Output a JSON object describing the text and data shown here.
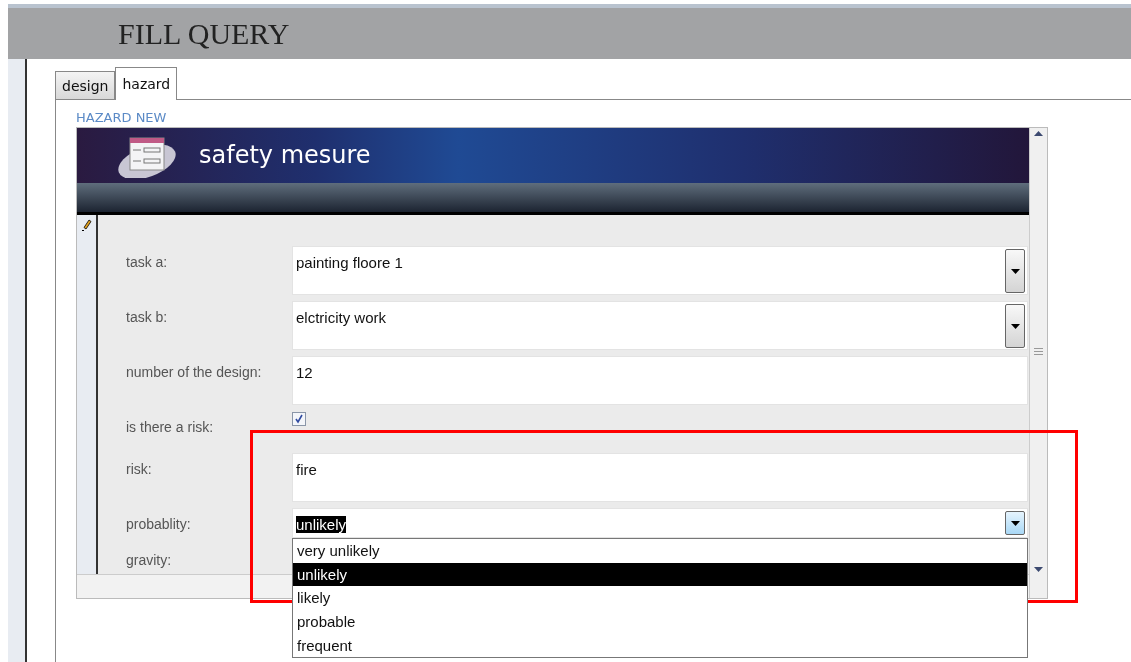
{
  "window": {
    "title": "FILL QUERY"
  },
  "tabs": [
    {
      "label": "design",
      "selected": false
    },
    {
      "label": "hazard",
      "selected": true
    }
  ],
  "form": {
    "caption": "HAZARD NEW",
    "header_title": "safety mesure",
    "fields": [
      {
        "label": "task a:",
        "kind": "combo",
        "value": "painting floore 1"
      },
      {
        "label": "task b:",
        "kind": "combo",
        "value": "elctricity work"
      },
      {
        "label": "number of the design:",
        "kind": "text",
        "value": "12"
      },
      {
        "label": "is there a risk:",
        "kind": "checkbox",
        "checked": true
      },
      {
        "label": "risk:",
        "kind": "text",
        "value": "fire"
      },
      {
        "label": "probablity:",
        "kind": "combo",
        "value": "unlikely",
        "open": true,
        "options": [
          {
            "label": "very unlikely",
            "selected": false
          },
          {
            "label": "unlikely",
            "selected": true
          },
          {
            "label": "likely",
            "selected": false
          },
          {
            "label": "probable",
            "selected": false
          },
          {
            "label": "frequent",
            "selected": false
          }
        ]
      },
      {
        "label": "gravity:",
        "kind": "covered"
      }
    ]
  }
}
